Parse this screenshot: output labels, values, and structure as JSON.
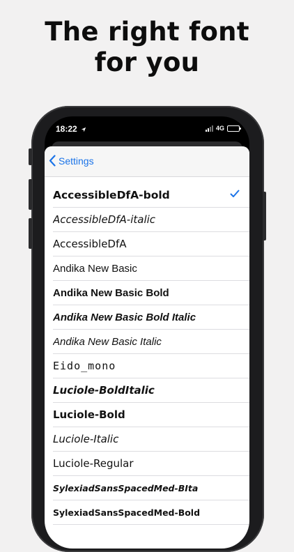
{
  "headline": {
    "line1": "The right font",
    "line2": "for you"
  },
  "status_bar": {
    "time": "18:22",
    "network": "4G"
  },
  "nav": {
    "back_label": "Settings"
  },
  "fonts": [
    {
      "label": "AccessibleDfA-bold",
      "selected": true
    },
    {
      "label": "AccessibleDfA-italic",
      "selected": false
    },
    {
      "label": "AccessibleDfA",
      "selected": false
    },
    {
      "label": "Andika New Basic",
      "selected": false
    },
    {
      "label": "Andika New Basic Bold",
      "selected": false
    },
    {
      "label": "Andika New Basic Bold Italic",
      "selected": false
    },
    {
      "label": "Andika New Basic Italic",
      "selected": false
    },
    {
      "label": "Eido_mono",
      "selected": false
    },
    {
      "label": "Luciole-BoldItalic",
      "selected": false
    },
    {
      "label": "Luciole-Bold",
      "selected": false
    },
    {
      "label": "Luciole-Italic",
      "selected": false
    },
    {
      "label": "Luciole-Regular",
      "selected": false
    },
    {
      "label": "SylexiadSansSpacedMed-BIta",
      "selected": false
    },
    {
      "label": "SylexiadSansSpacedMed-Bold",
      "selected": false
    }
  ],
  "colors": {
    "accent": "#1a73e8",
    "battery": "#34c759",
    "background": "#f2f1f1"
  },
  "icons": {
    "back": "chevron-left-icon",
    "selected": "checkmark-icon",
    "location": "location-arrow-icon"
  }
}
